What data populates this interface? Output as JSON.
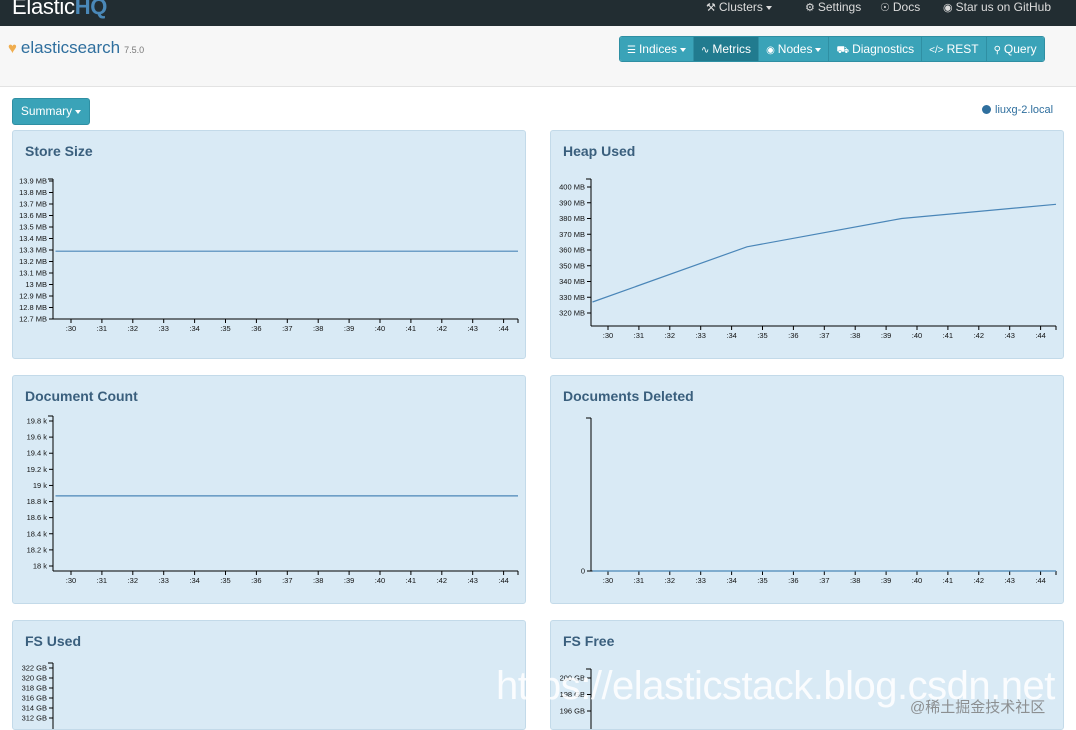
{
  "nav": {
    "brand_a": "Elastic",
    "brand_b": "HQ",
    "clusters": "Clusters",
    "settings": "Settings",
    "docs": "Docs",
    "github": "Star us on GitHub"
  },
  "cluster": {
    "name": "elasticsearch",
    "version": "7.5.0"
  },
  "toolbar": {
    "indices": "Indices",
    "metrics": "Metrics",
    "nodes": "Nodes",
    "diagnostics": "Diagnostics",
    "rest": "REST",
    "query": "Query"
  },
  "summary_label": "Summary",
  "node_name": "liuxg-2.local",
  "colors": {
    "line": "#4a86b8",
    "panel": "#d9eaf5",
    "title": "#3a5f7d",
    "button": "#3aa3b8"
  },
  "chart_data": [
    {
      "type": "line",
      "title": "Store Size",
      "x": [
        ":30",
        ":31",
        ":32",
        ":33",
        ":34",
        ":35",
        ":36",
        ":37",
        ":38",
        ":39",
        ":40",
        ":41",
        ":42",
        ":43",
        ":44"
      ],
      "y_ticks": [
        "13.9 MB",
        "13.8 MB",
        "13.7 MB",
        "13.6 MB",
        "13.5 MB",
        "13.4 MB",
        "13.3 MB",
        "13.2 MB",
        "13.1 MB",
        "13 MB",
        "12.9 MB",
        "12.8 MB",
        "12.7 MB"
      ],
      "y_tick_values": [
        13.9,
        13.8,
        13.7,
        13.6,
        13.5,
        13.4,
        13.3,
        13.2,
        13.1,
        13.0,
        12.9,
        12.8,
        12.7
      ],
      "ylim": [
        12.7,
        13.9
      ],
      "series": [
        {
          "x": [
            29.5,
            44.5
          ],
          "values": [
            13.29,
            13.29
          ]
        }
      ]
    },
    {
      "type": "line",
      "title": "Heap Used",
      "x": [
        ":30",
        ":31",
        ":32",
        ":33",
        ":34",
        ":35",
        ":36",
        ":37",
        ":38",
        ":39",
        ":40",
        ":41",
        ":42",
        ":43",
        ":44"
      ],
      "y_ticks": [
        "400 MB",
        "390 MB",
        "380 MB",
        "370 MB",
        "360 MB",
        "350 MB",
        "340 MB",
        "330 MB",
        "320 MB"
      ],
      "y_tick_values": [
        400,
        390,
        380,
        370,
        360,
        350,
        340,
        330,
        320
      ],
      "ylim": [
        320,
        400
      ],
      "series": [
        {
          "x": [
            29.5,
            34.5,
            39.5,
            44.5
          ],
          "values": [
            327,
            362,
            380,
            389
          ]
        }
      ]
    },
    {
      "type": "line",
      "title": "Document Count",
      "x": [
        ":30",
        ":31",
        ":32",
        ":33",
        ":34",
        ":35",
        ":36",
        ":37",
        ":38",
        ":39",
        ":40",
        ":41",
        ":42",
        ":43",
        ":44"
      ],
      "y_ticks": [
        "19.8 k",
        "19.6 k",
        "19.4 k",
        "19.2 k",
        "19 k",
        "18.8 k",
        "18.6 k",
        "18.4 k",
        "18.2 k",
        "18 k"
      ],
      "y_tick_values": [
        19.8,
        19.6,
        19.4,
        19.2,
        19.0,
        18.8,
        18.6,
        18.4,
        18.2,
        18.0
      ],
      "ylim": [
        18.0,
        19.8
      ],
      "series": [
        {
          "x": [
            29.5,
            44.5
          ],
          "values": [
            18.87,
            18.87
          ]
        }
      ]
    },
    {
      "type": "line",
      "title": "Documents Deleted",
      "x": [
        ":30",
        ":31",
        ":32",
        ":33",
        ":34",
        ":35",
        ":36",
        ":37",
        ":38",
        ":39",
        ":40",
        ":41",
        ":42",
        ":43",
        ":44"
      ],
      "y_ticks": [
        "0"
      ],
      "y_tick_values": [
        0
      ],
      "ylim": [
        0,
        1
      ],
      "series": [
        {
          "x": [
            29.5,
            44.5
          ],
          "values": [
            0,
            0
          ]
        }
      ]
    },
    {
      "type": "line",
      "title": "FS Used",
      "x": [],
      "y_ticks": [
        "322 GB",
        "320 GB",
        "318 GB",
        "316 GB",
        "314 GB",
        "312 GB"
      ],
      "y_tick_values": [
        322,
        320,
        318,
        316,
        314,
        312
      ],
      "ylim": [
        312,
        322
      ],
      "series": []
    },
    {
      "type": "line",
      "title": "FS Free",
      "x": [],
      "y_ticks": [
        "200 GB",
        "198 GB",
        "196 GB"
      ],
      "y_tick_values": [
        200,
        198,
        196
      ],
      "ylim": [
        196,
        200
      ],
      "series": []
    }
  ],
  "watermark": "https://elasticstack.blog.csdn.net",
  "watermark_cn": "@稀土掘金技术社区"
}
